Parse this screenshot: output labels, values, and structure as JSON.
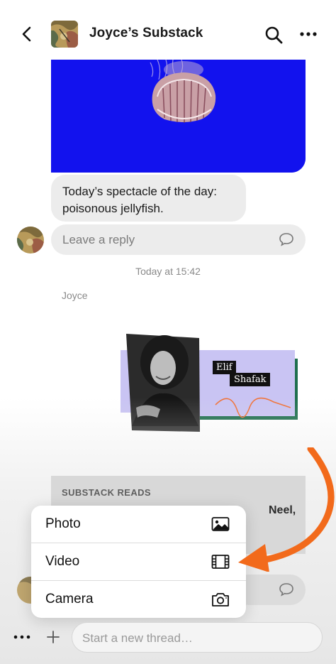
{
  "header": {
    "title": "Joyce’s Substack",
    "back_icon": "chevron-left-icon",
    "search_icon": "search-icon",
    "more_icon": "more-horizontal-icon"
  },
  "post": {
    "text_line1": "Today’s spectacle of the day:",
    "text_line2": "poisonous jellyfish.",
    "reply_placeholder": "Leave a reply",
    "timestamp": "Today at 15:42",
    "author": "Joyce"
  },
  "promo": {
    "name_line1": "Elif",
    "name_line2": "Shafak",
    "colors": {
      "lavender": "#c9c4f3",
      "green": "#1f6f4e",
      "orange": "#f0743a"
    }
  },
  "card": {
    "label": "SUBSTACK READS",
    "peek_text": "N",
    "peek_text_right": "Neel,"
  },
  "menu": {
    "items": [
      {
        "label": "Photo",
        "icon": "photo-icon"
      },
      {
        "label": "Video",
        "icon": "film-icon"
      },
      {
        "label": "Camera",
        "icon": "camera-icon"
      }
    ]
  },
  "composer": {
    "placeholder": "Start a new thread…",
    "more_icon": "more-horizontal-icon",
    "plus_icon": "plus-icon"
  },
  "colors": {
    "jellyfish_bg": "#1212ee",
    "bubble_bg": "#ececec",
    "annotation_arrow": "#f26a1b"
  }
}
